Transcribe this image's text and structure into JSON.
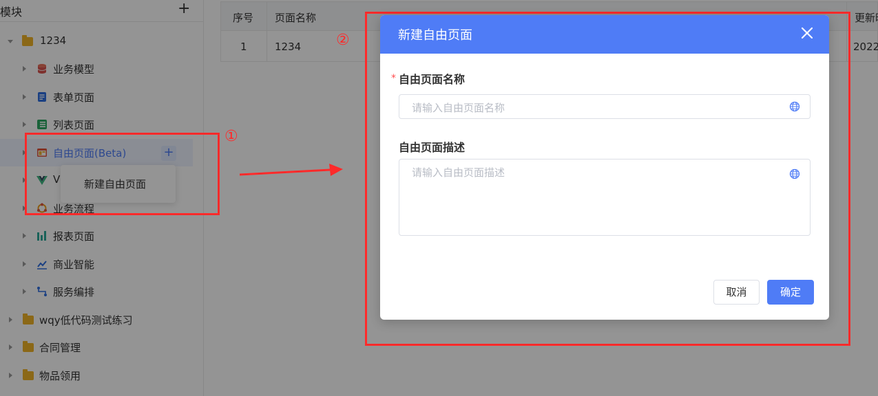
{
  "sidebar": {
    "title": "模块",
    "add_label": "+",
    "root": "1234",
    "items": [
      {
        "label": "业务模型",
        "icon": "database-icon"
      },
      {
        "label": "表单页面",
        "icon": "form-icon"
      },
      {
        "label": "列表页面",
        "icon": "list-icon"
      },
      {
        "label": "自由页面(Beta)",
        "icon": "layout-icon"
      },
      {
        "label": "V",
        "icon": "vue-icon"
      },
      {
        "label": "业务流程",
        "icon": "workflow-icon"
      },
      {
        "label": "报表页面",
        "icon": "report-icon"
      },
      {
        "label": "商业智能",
        "icon": "bi-icon"
      },
      {
        "label": "服务编排",
        "icon": "service-icon"
      }
    ],
    "folders": [
      "wqy低代码测试练习",
      "合同管理",
      "物品领用"
    ],
    "active_plus": "+"
  },
  "context_menu": {
    "item": "新建自由页面"
  },
  "table": {
    "headers": [
      "序号",
      "页面名称",
      "更新时"
    ],
    "row": {
      "index": "1",
      "name": "1234",
      "updated": "2022"
    }
  },
  "annotations": {
    "one": "①",
    "two": "②"
  },
  "modal": {
    "title": "新建自由页面",
    "required_mark": "*",
    "name_label": "自由页面名称",
    "name_placeholder": "请输入自由页面名称",
    "desc_label": "自由页面描述",
    "desc_placeholder": "请输入自由页面描述",
    "cancel": "取消",
    "ok": "确定"
  },
  "colors": {
    "primary": "#4f7cf6",
    "annotation": "#ff2a2a",
    "folder": "#f0b429"
  }
}
